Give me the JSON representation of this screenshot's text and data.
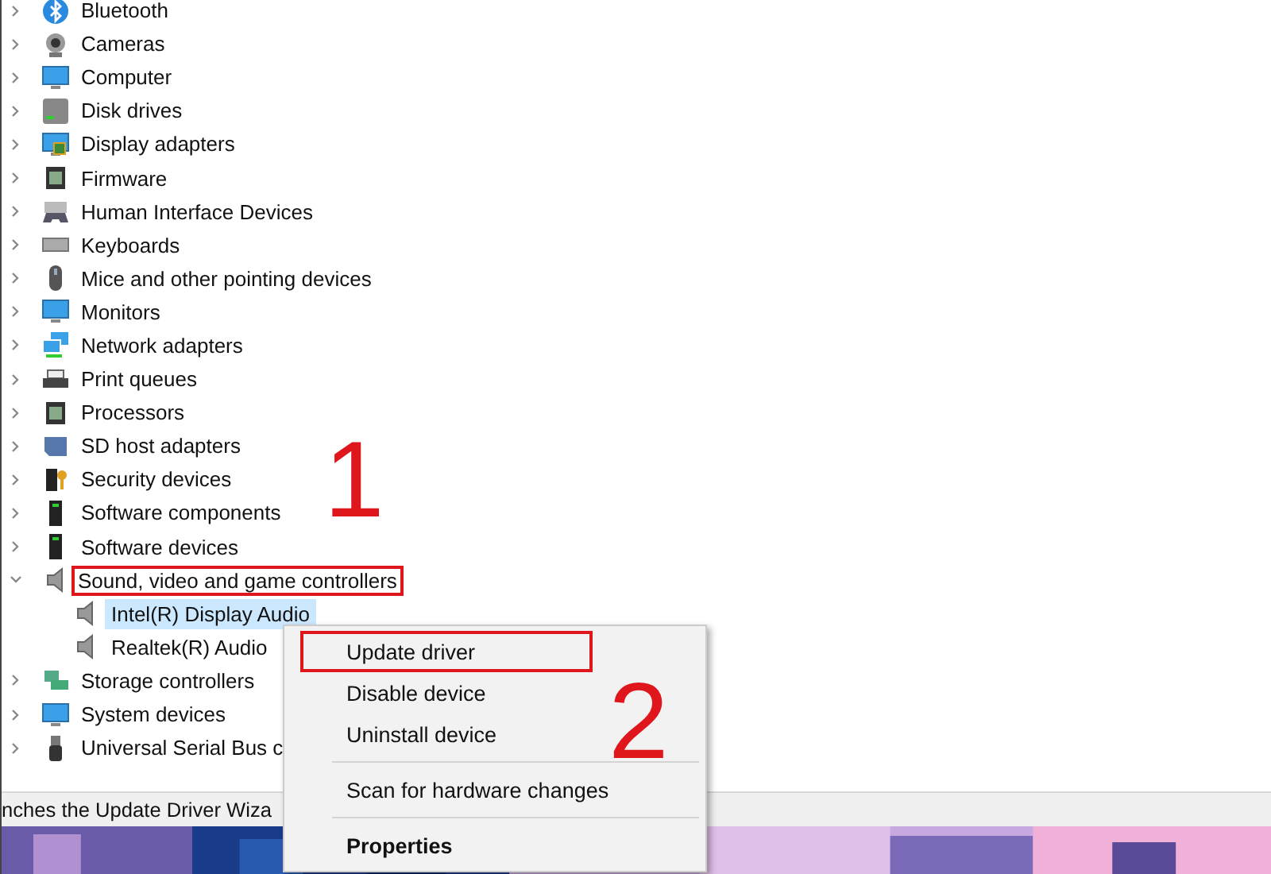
{
  "tree": {
    "items": [
      {
        "label": "Bluetooth",
        "expanded": false
      },
      {
        "label": "Cameras",
        "expanded": false
      },
      {
        "label": "Computer",
        "expanded": false
      },
      {
        "label": "Disk drives",
        "expanded": false
      },
      {
        "label": "Display adapters",
        "expanded": false
      },
      {
        "label": "Firmware",
        "expanded": false
      },
      {
        "label": "Human Interface Devices",
        "expanded": false
      },
      {
        "label": "Keyboards",
        "expanded": false
      },
      {
        "label": "Mice and other pointing devices",
        "expanded": false
      },
      {
        "label": "Monitors",
        "expanded": false
      },
      {
        "label": "Network adapters",
        "expanded": false
      },
      {
        "label": "Print queues",
        "expanded": false
      },
      {
        "label": "Processors",
        "expanded": false
      },
      {
        "label": "SD host adapters",
        "expanded": false
      },
      {
        "label": "Security devices",
        "expanded": false
      },
      {
        "label": "Software components",
        "expanded": false
      },
      {
        "label": "Software devices",
        "expanded": false
      },
      {
        "label": "Sound, video and game controllers",
        "expanded": true,
        "highlighted": true,
        "children": [
          {
            "label": "Intel(R) Display Audio",
            "selected": true
          },
          {
            "label": "Realtek(R) Audio",
            "selected": false
          }
        ]
      },
      {
        "label": "Storage controllers",
        "expanded": false
      },
      {
        "label": "System devices",
        "expanded": false
      },
      {
        "label": "Universal Serial Bus c",
        "expanded": false
      }
    ]
  },
  "status_bar": "nches the Update Driver Wiza",
  "context_menu": {
    "items": [
      {
        "kind": "item",
        "label": "Update driver",
        "highlighted": true
      },
      {
        "kind": "item",
        "label": "Disable device"
      },
      {
        "kind": "item",
        "label": "Uninstall device"
      },
      {
        "kind": "separator"
      },
      {
        "kind": "item",
        "label": "Scan for hardware changes"
      },
      {
        "kind": "separator"
      },
      {
        "kind": "item",
        "label": "Properties",
        "default": true
      }
    ]
  },
  "step_markers": [
    "1",
    "2"
  ]
}
